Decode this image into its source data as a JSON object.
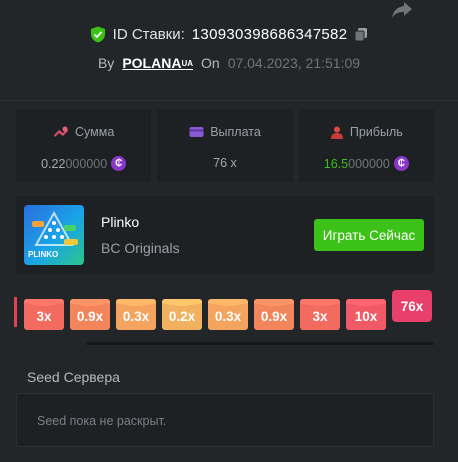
{
  "header": {
    "bet_id_label": "ID Ставки:",
    "bet_id_value": "130930398686347582",
    "by_label": "By",
    "username": "POLANA",
    "username_suffix": "UA",
    "on_label": "On",
    "datetime": "07.04.2023, 21:51:09"
  },
  "stats": [
    {
      "title": "Сумма",
      "value_main": "0.22",
      "value_dim": "000000",
      "icon": "coins-icon"
    },
    {
      "title": "Выплата",
      "value_main": "76 x",
      "value_dim": "",
      "icon": "wallet-icon"
    },
    {
      "title": "Прибыль",
      "value_main": "16.5",
      "value_dim": "000000",
      "icon": "profit-icon"
    }
  ],
  "game": {
    "name": "Plinko",
    "provider": "BC Originals",
    "play_label": "Играть Сейчас",
    "thumb_text": "PLINKO"
  },
  "multipliers": [
    {
      "label": "3x",
      "color": "#f36b5f"
    },
    {
      "label": "0.9x",
      "color": "#f3855c"
    },
    {
      "label": "0.3x",
      "color": "#f4a45e"
    },
    {
      "label": "0.2x",
      "color": "#f2b160"
    },
    {
      "label": "0.3x",
      "color": "#f4a45e"
    },
    {
      "label": "0.9x",
      "color": "#f3855c"
    },
    {
      "label": "3x",
      "color": "#f36b5f"
    },
    {
      "label": "10x",
      "color": "#f05a66"
    },
    {
      "label": "76x",
      "color": "#e8406a",
      "hit": true
    }
  ],
  "seed": {
    "label": "Seed Сервера",
    "value": "Seed пока не раскрыт."
  },
  "colors": {
    "background": "#232628",
    "panel": "#1e2123",
    "accent_green": "#3bc117",
    "coin_purple": "#8a37c8"
  }
}
